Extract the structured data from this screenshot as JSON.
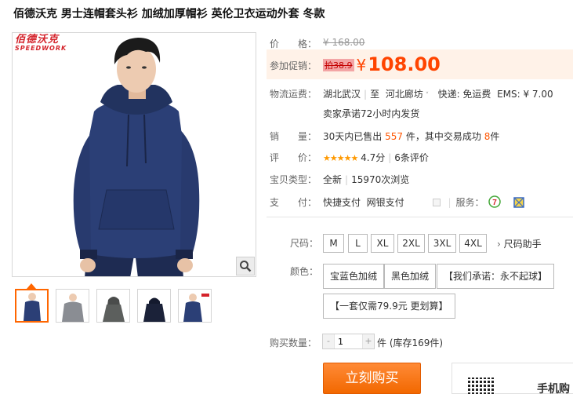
{
  "product": {
    "title": "佰德沃克 男士连帽套头衫 加绒加厚帽衫 英伦卫衣运动外套 冬款",
    "brand_cn": "佰德沃克",
    "brand_en": "SPEEDWORK"
  },
  "price": {
    "label": "价　　格：",
    "original": "¥ 168.00"
  },
  "promo": {
    "label": "参加促销：",
    "discount_tag": "拍38.9",
    "yen": "¥",
    "price": "108.00"
  },
  "shipping": {
    "label": "物流运费：",
    "route_from": "湖北武汉",
    "to_word": "至",
    "route_to": "河北廊坊",
    "express": "快递: 免运费",
    "ems": "EMS: ¥ 7.00",
    "promise": "卖家承诺72小时内发货"
  },
  "sales": {
    "label": "销　　量：",
    "prefix": "30天内已售出",
    "sold": "557",
    "mid": "件，其中交易成功",
    "success": "8",
    "suffix": "件"
  },
  "rating": {
    "label": "评　　价：",
    "stars": "★★★★★",
    "score": "4.7分",
    "reviews": "6条评价"
  },
  "item_type": {
    "label": "宝贝类型：",
    "condition": "全新",
    "views": "15970次浏览"
  },
  "payment": {
    "label": "支　　付：",
    "method1": "快捷支付",
    "method2": "网银支付",
    "service_label": "服务："
  },
  "size": {
    "label": "尺码：",
    "options": [
      "M",
      "L",
      "XL",
      "2XL",
      "3XL",
      "4XL"
    ],
    "helper": "尺码助手"
  },
  "color": {
    "label": "颜色：",
    "options": [
      "宝蓝色加绒",
      "黑色加绒",
      "【我们承诺：永不起球】",
      "【一套仅需79.9元 更划算】"
    ]
  },
  "quantity": {
    "label": "购买数量：",
    "minus": "-",
    "value": "1",
    "plus": "+",
    "unit_prefix": "件",
    "stock": "(库存169件)"
  },
  "actions": {
    "buy_now": "立刻购买",
    "mobile_buy": "手机购"
  },
  "colors": {
    "accent": "#ff4400",
    "hoodie": "#283a6e",
    "brand_red": "#d4232b"
  }
}
